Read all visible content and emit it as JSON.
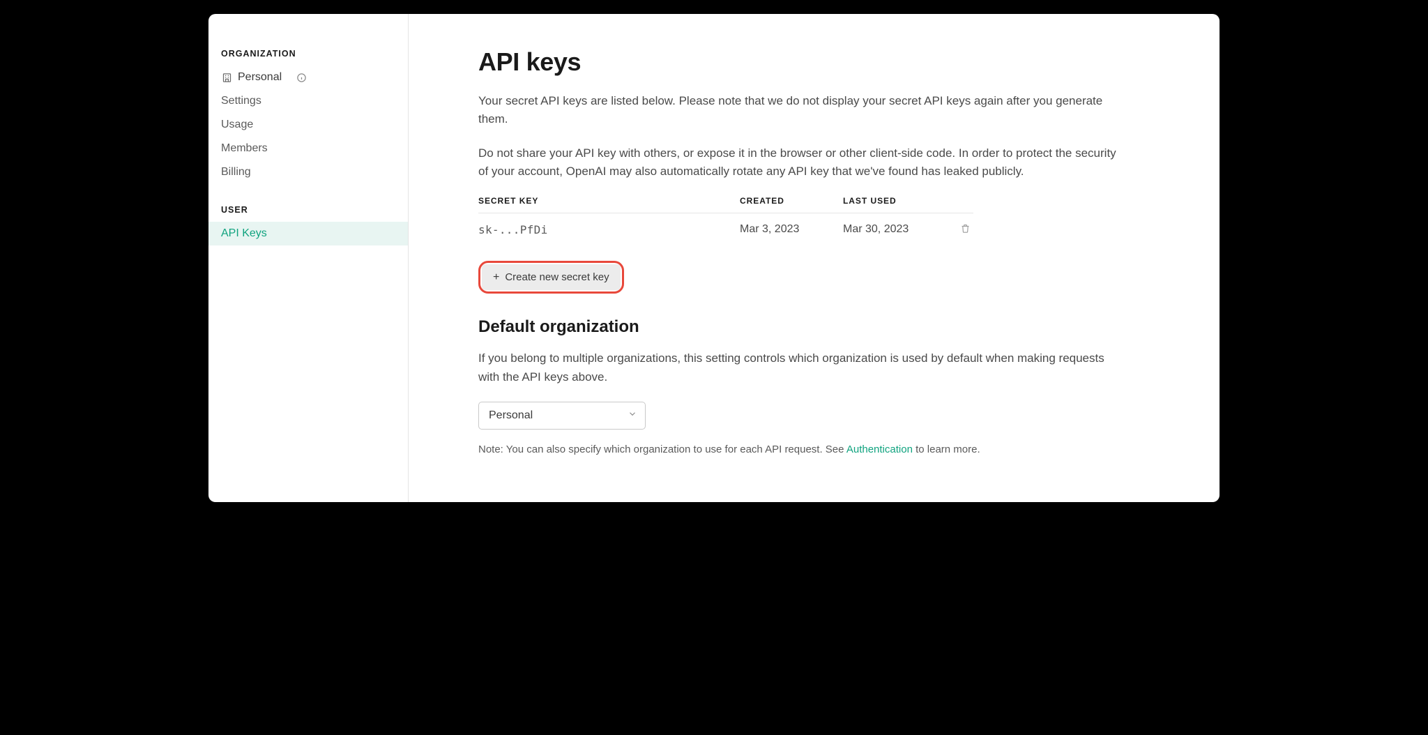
{
  "sidebar": {
    "org_label": "ORGANIZATION",
    "personal": "Personal",
    "items": {
      "settings": "Settings",
      "usage": "Usage",
      "members": "Members",
      "billing": "Billing"
    },
    "user_label": "USER",
    "api_keys": "API Keys"
  },
  "main": {
    "title": "API keys",
    "intro1": "Your secret API keys are listed below. Please note that we do not display your secret API keys again after you generate them.",
    "intro2": "Do not share your API key with others, or expose it in the browser or other client-side code. In order to protect the security of your account, OpenAI may also automatically rotate any API key that we've found has leaked publicly.",
    "table": {
      "headers": {
        "key": "SECRET KEY",
        "created": "CREATED",
        "used": "LAST USED"
      },
      "rows": [
        {
          "key": "sk-...PfDi",
          "created": "Mar 3, 2023",
          "used": "Mar 30, 2023"
        }
      ]
    },
    "create_button": "Create new secret key",
    "default_org": {
      "title": "Default organization",
      "desc": "If you belong to multiple organizations, this setting controls which organization is used by default when making requests with the API keys above.",
      "selected": "Personal",
      "note_prefix": "Note: You can also specify which organization to use for each API request. See ",
      "note_link": "Authentication",
      "note_suffix": " to learn more."
    }
  }
}
